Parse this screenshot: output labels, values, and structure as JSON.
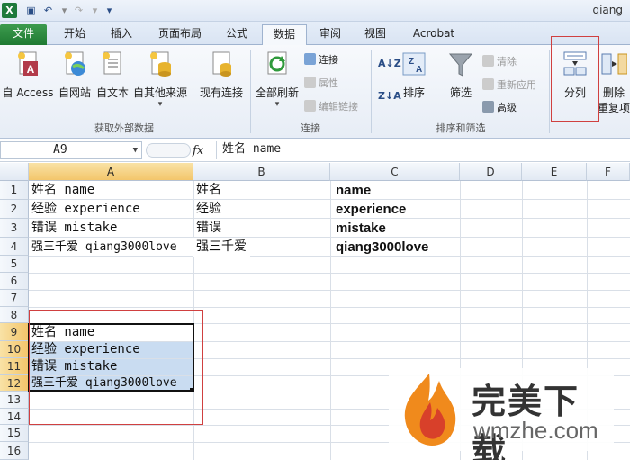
{
  "window": {
    "title": "qiang"
  },
  "tabs": [
    {
      "label": "文件"
    },
    {
      "label": "开始"
    },
    {
      "label": "插入"
    },
    {
      "label": "页面布局"
    },
    {
      "label": "公式"
    },
    {
      "label": "数据"
    },
    {
      "label": "审阅"
    },
    {
      "label": "视图"
    },
    {
      "label": "Acrobat"
    }
  ],
  "ribbon": {
    "external": {
      "access": "自 Access",
      "web": "自网站",
      "text": "自文本",
      "other": "自其他来源",
      "existing": "现有连接",
      "group": "获取外部数据"
    },
    "connections": {
      "refresh": "全部刷新",
      "connect": "连接",
      "props": "属性",
      "edit_links": "编辑链接",
      "group": "连接"
    },
    "sort": {
      "sort": "排序",
      "filter": "筛选",
      "clear": "清除",
      "reapply": "重新应用",
      "advanced": "高级",
      "group": "排序和筛选"
    },
    "tools": {
      "split": "分列",
      "remove_dup_1": "删除",
      "remove_dup_2": "重复项"
    }
  },
  "formula_bar": {
    "name_box": "A9",
    "fx": "fx",
    "content": "姓名 name"
  },
  "grid": {
    "columns": [
      "A",
      "B",
      "C",
      "D",
      "E",
      "F"
    ],
    "rows": [
      "1",
      "2",
      "3",
      "4",
      "5",
      "6",
      "7",
      "8",
      "9",
      "10",
      "11",
      "12",
      "13",
      "14",
      "15",
      "16"
    ],
    "cells": {
      "A1": "姓名 name",
      "B1": "姓名",
      "C1": "name",
      "A2": "经验 experience",
      "B2": "经验",
      "C2": "experience",
      "A3": "错误 mistake",
      "B3": "错误",
      "C3": "mistake",
      "A4": "强三千爱 qiang3000love",
      "B4": "强三千爱",
      "C4": "qiang3000love",
      "A9": "姓名 name",
      "A10": "经验 experience",
      "A11": "错误 mistake",
      "A12": "强三千爱 qiang3000love"
    }
  },
  "watermark": {
    "brand": "完美下载",
    "domain": "wmzhe.com"
  }
}
